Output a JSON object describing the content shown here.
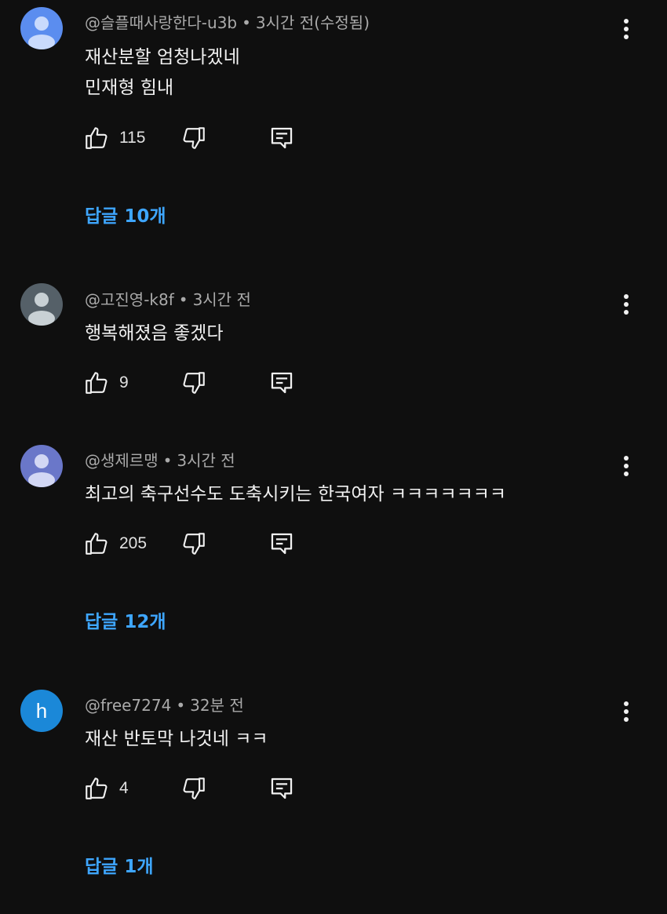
{
  "colors": {
    "background": "#0f0f0f",
    "text": "#f1f1f1",
    "meta": "#aaaaaa",
    "link": "#3ea6ff"
  },
  "icons": {
    "like": "thumbs-up-icon",
    "dislike": "thumbs-down-icon",
    "reply": "reply-icon",
    "more": "more-vertical-icon"
  },
  "comments": [
    {
      "author": "@슬플때사랑한다-u3b",
      "time": "3시간 전(수정됨)",
      "text_lines": [
        "재산분할 엄청나겠네",
        "민재형 힘내"
      ],
      "likes": "115",
      "replies": "답글 10개",
      "avatar_color": "#5b8def"
    },
    {
      "author": "@고진영-k8f",
      "time": "3시간 전",
      "text_lines": [
        "행복해졌음 좋겠다"
      ],
      "likes": "9",
      "avatar_color": "#556068"
    },
    {
      "author": "@생제르맹",
      "time": "3시간 전",
      "text_lines": [
        "최고의 축구선수도 도축시키는 한국여자 ㅋㅋㅋㅋㅋㅋㅋ"
      ],
      "likes": "205",
      "replies": "답글 12개",
      "avatar_color": "#6a77c9"
    },
    {
      "author": "@free7274",
      "time": "32분 전",
      "text_lines": [
        "재산 반토막 나것네 ㅋㅋ"
      ],
      "likes": "4",
      "replies": "답글 1개",
      "avatar_letter": "h",
      "avatar_color": "#1b88d8"
    }
  ]
}
